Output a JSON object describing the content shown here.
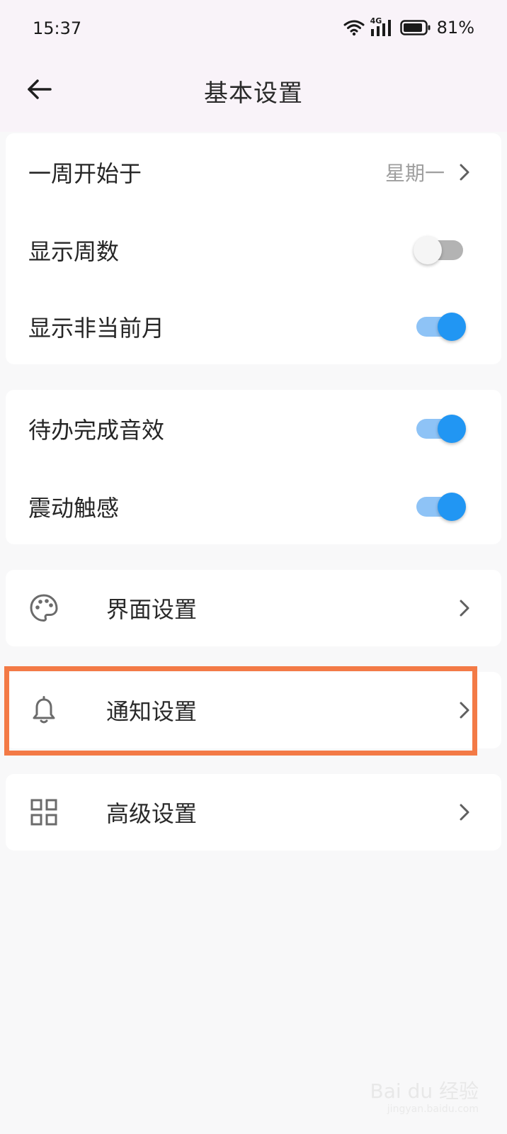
{
  "status_bar": {
    "time": "15:37",
    "network_badge": "4G",
    "battery": "81%",
    "battery_level": 0.81
  },
  "header": {
    "title": "基本设置",
    "back_icon": "arrow-left-icon"
  },
  "calendar_section": {
    "week_start": {
      "label": "一周开始于",
      "value": "星期一"
    },
    "show_week_numbers": {
      "label": "显示周数",
      "on": false
    },
    "show_other_months": {
      "label": "显示非当前月",
      "on": true
    }
  },
  "feedback_section": {
    "todo_sound": {
      "label": "待办完成音效",
      "on": true
    },
    "vibration": {
      "label": "震动触感",
      "on": true
    }
  },
  "nav_items": {
    "interface": {
      "label": "界面设置",
      "icon": "palette-icon"
    },
    "notification": {
      "label": "通知设置",
      "icon": "bell-icon"
    },
    "advanced": {
      "label": "高级设置",
      "icon": "grid-icon"
    }
  },
  "colors": {
    "accent": "#2196f3",
    "accent_light": "#8ec3f6",
    "highlight": "#f37a46",
    "header_bg": "#f9f3f9"
  },
  "watermark": {
    "brand": "Bai du 经验",
    "url": "jingyan.baidu.com"
  }
}
